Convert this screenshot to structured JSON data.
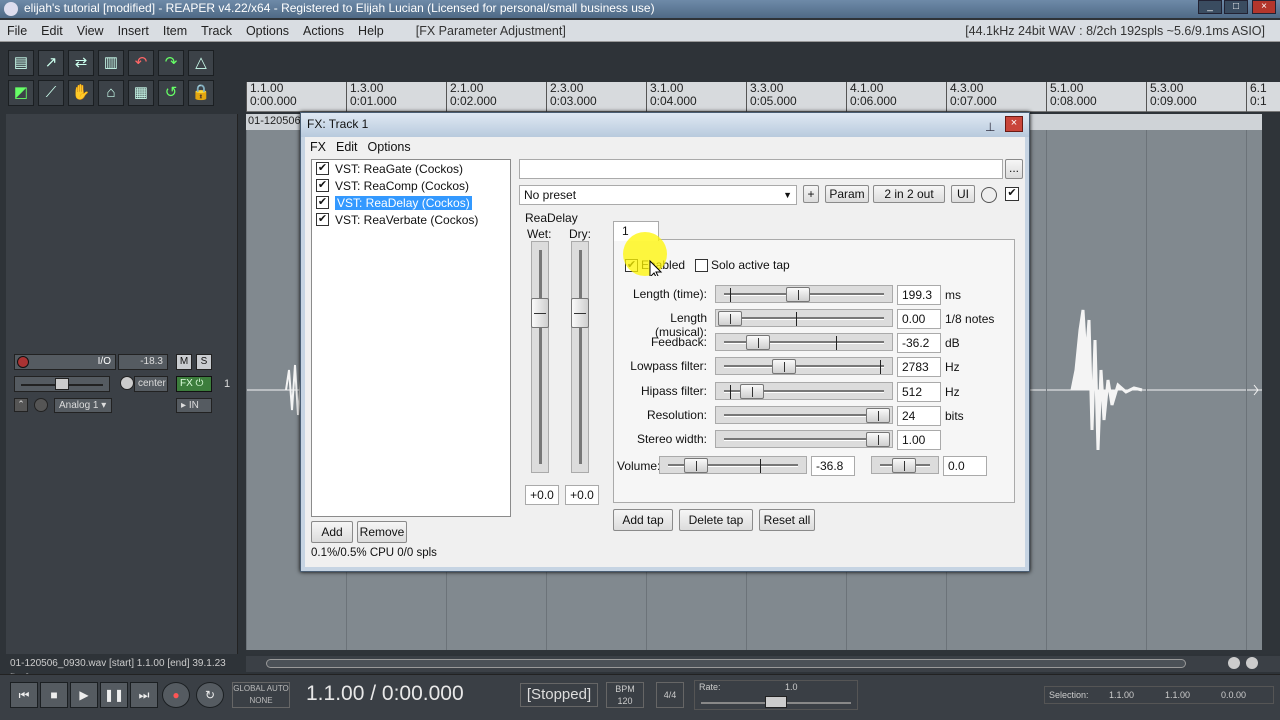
{
  "window": {
    "title": "elijah's tutorial [modified] - REAPER v4.22/x64 - Registered to Elijah Lucian (Licensed for personal/small business use)"
  },
  "menu": {
    "items": [
      "File",
      "Edit",
      "View",
      "Insert",
      "Item",
      "Track",
      "Options",
      "Actions",
      "Help"
    ],
    "fx_param": "[FX Parameter Adjustment]",
    "status": "[44.1kHz 24bit WAV : 8/2ch 192spls ~5.6/9.1ms ASIO]"
  },
  "ruler": {
    "marks": [
      {
        "bar": "1.1.00",
        "time": "0:00.000"
      },
      {
        "bar": "1.3.00",
        "time": "0:01.000"
      },
      {
        "bar": "2.1.00",
        "time": "0:02.000"
      },
      {
        "bar": "2.3.00",
        "time": "0:03.000"
      },
      {
        "bar": "3.1.00",
        "time": "0:04.000"
      },
      {
        "bar": "3.3.00",
        "time": "0:05.000"
      },
      {
        "bar": "4.1.00",
        "time": "0:06.000"
      },
      {
        "bar": "4.3.00",
        "time": "0:07.000"
      },
      {
        "bar": "5.1.00",
        "time": "0:08.000"
      },
      {
        "bar": "5.3.00",
        "time": "0:09.000"
      },
      {
        "bar": "6.1",
        "time": "0:1"
      }
    ]
  },
  "track": {
    "number": "1",
    "io": "I/O",
    "volume": "-18.3",
    "mute": "M",
    "solo": "S",
    "pan": "center",
    "fx": "FX",
    "input": "Analog 1",
    "in": "IN",
    "item_name": "01-120506"
  },
  "status_left": "01-120506_0930.wav [start] 1.1.00 [end] 39.1.23 [len]",
  "fx_window": {
    "title": "FX: Track 1",
    "menu": [
      "FX",
      "Edit",
      "Options"
    ],
    "chain": [
      {
        "label": "VST: ReaGate (Cockos)",
        "checked": true
      },
      {
        "label": "VST: ReaComp (Cockos)",
        "checked": true
      },
      {
        "label": "VST: ReaDelay (Cockos)",
        "checked": true,
        "selected": true
      },
      {
        "label": "VST: ReaVerbate (Cockos)",
        "checked": true
      }
    ],
    "add": "Add",
    "remove": "Remove",
    "cpu": "0.1%/0.5% CPU 0/0 spls",
    "preset": "No preset",
    "plus": "+",
    "param": "Param",
    "io": "2 in 2 out",
    "ui": "UI",
    "more": "...",
    "plugin_name": "ReaDelay",
    "wet_label": "Wet:",
    "dry_label": "Dry:",
    "wet_value": "+0.0",
    "dry_value": "+0.0",
    "tab": "1",
    "enabled_label": "Enabled",
    "solo_label": "Solo active tap",
    "params": [
      {
        "label": "Length (time):",
        "value": "199.3",
        "unit": "ms"
      },
      {
        "label": "Length (musical):",
        "value": "0.00",
        "unit": "1/8 notes"
      },
      {
        "label": "Feedback:",
        "value": "-36.2",
        "unit": "dB"
      },
      {
        "label": "Lowpass filter:",
        "value": "2783",
        "unit": "Hz"
      },
      {
        "label": "Hipass filter:",
        "value": "512",
        "unit": "Hz"
      },
      {
        "label": "Resolution:",
        "value": "24",
        "unit": "bits"
      },
      {
        "label": "Stereo width:",
        "value": "1.00",
        "unit": ""
      }
    ],
    "volume_label": "Volume:",
    "volume_value": "-36.8",
    "pan_value": "0.0",
    "add_tap": "Add tap",
    "delete_tap": "Delete tap",
    "reset_all": "Reset all"
  },
  "transport": {
    "time": "1.1.00 / 0:00.000",
    "state": "[Stopped]",
    "global_auto": "GLOBAL AUTO",
    "none": "NONE",
    "bpm_label": "BPM",
    "bpm": "120",
    "sig": "4/4",
    "rate_label": "Rate:",
    "rate": "1.0",
    "selection_label": "Selection:",
    "sel_start": "1.1.00",
    "sel_end": "1.1.00",
    "sel_len": "0.0.00"
  }
}
